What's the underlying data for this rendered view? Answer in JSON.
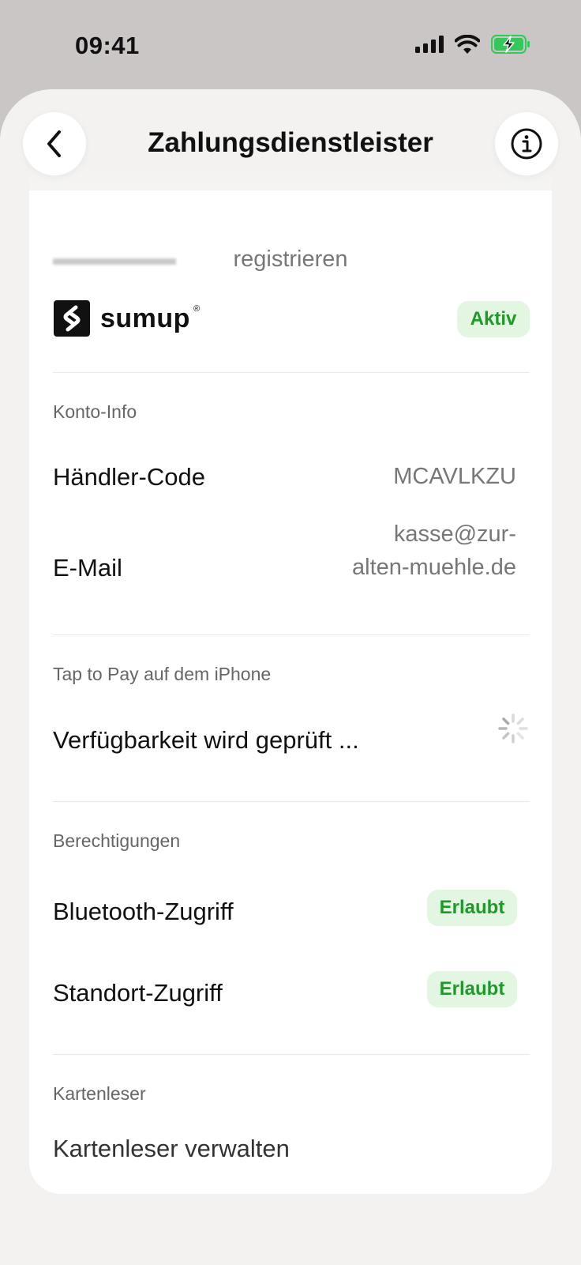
{
  "status_bar": {
    "time": "09:41",
    "icons": [
      "cellular-signal-icon",
      "wifi-icon",
      "battery-charging-icon"
    ],
    "battery_color": "#34c759"
  },
  "header": {
    "title": "Zahlungsdienstleister",
    "back_icon": "chevron-left-icon",
    "info_icon": "info-icon"
  },
  "previous_card": {
    "text": "registrieren"
  },
  "provider": {
    "brand": "sumup",
    "status": "Aktiv",
    "status_color": "#1f9a2a",
    "status_bg": "#e3f6e1"
  },
  "account_info": {
    "section_label": "Konto-Info",
    "merchant_code_label": "Händler-Code",
    "merchant_code_value": "MCAVLKZU",
    "email_label": "E-Mail",
    "email_value_line1": "kasse@zur-",
    "email_value_line2": "alten-muehle.de"
  },
  "tap_to_pay": {
    "section_label": "Tap to Pay auf dem iPhone",
    "status_text": "Verfügbarkeit wird geprüft ...",
    "spinner_icon": "loading-spinner-icon"
  },
  "permissions": {
    "section_label": "Berechtigungen",
    "items": [
      {
        "label": "Bluetooth-Zugriff",
        "status": "Erlaubt"
      },
      {
        "label": "Standort-Zugriff",
        "status": "Erlaubt"
      }
    ]
  },
  "card_reader": {
    "section_label": "Kartenleser",
    "manage_label": "Kartenleser verwalten"
  }
}
